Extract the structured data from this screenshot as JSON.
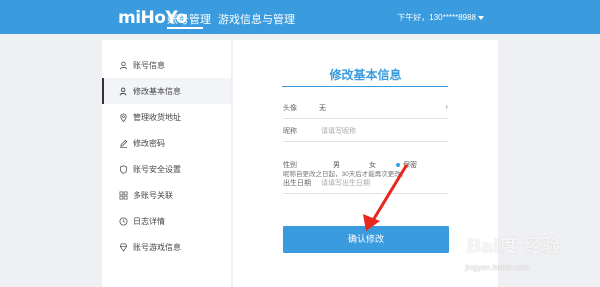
{
  "topbar": {
    "logo": "miHoYo",
    "nav": {
      "account": "账号管理",
      "game": "游戏信息与管理"
    },
    "user": "下午好，130*****8988",
    "accent": "#3a9bde"
  },
  "sidebar": {
    "items": [
      {
        "label": "账号信息",
        "icon": "user-icon"
      },
      {
        "label": "修改基本信息",
        "icon": "user-edit-icon",
        "active": true
      },
      {
        "label": "管理收货地址",
        "icon": "location-pin-icon"
      },
      {
        "label": "修改密码",
        "icon": "pen-icon"
      },
      {
        "label": "账号安全设置",
        "icon": "shield-icon"
      },
      {
        "label": "多账号关联",
        "icon": "link-accounts-icon"
      },
      {
        "label": "日志详情",
        "icon": "clock-icon"
      },
      {
        "label": "账号游戏信息",
        "icon": "game-icon"
      }
    ]
  },
  "form": {
    "title": "修改基本信息",
    "avatar_label": "头像",
    "avatar_value": "无",
    "nickname_label": "昵称",
    "nickname_placeholder": "请填写昵称",
    "nickname_hint": "昵称自更改之日起，30天后才能再次更改。",
    "gender_label": "性别",
    "gender_options": [
      "男",
      "女",
      "保密"
    ],
    "gender_selected": "保密",
    "birthday_label": "出生日期",
    "birthday_placeholder": "请填写出生日期",
    "confirm_button": "确认修改"
  },
  "watermark": {
    "brand": "Bai度 经验",
    "url": "jingyan.baidu.com"
  }
}
